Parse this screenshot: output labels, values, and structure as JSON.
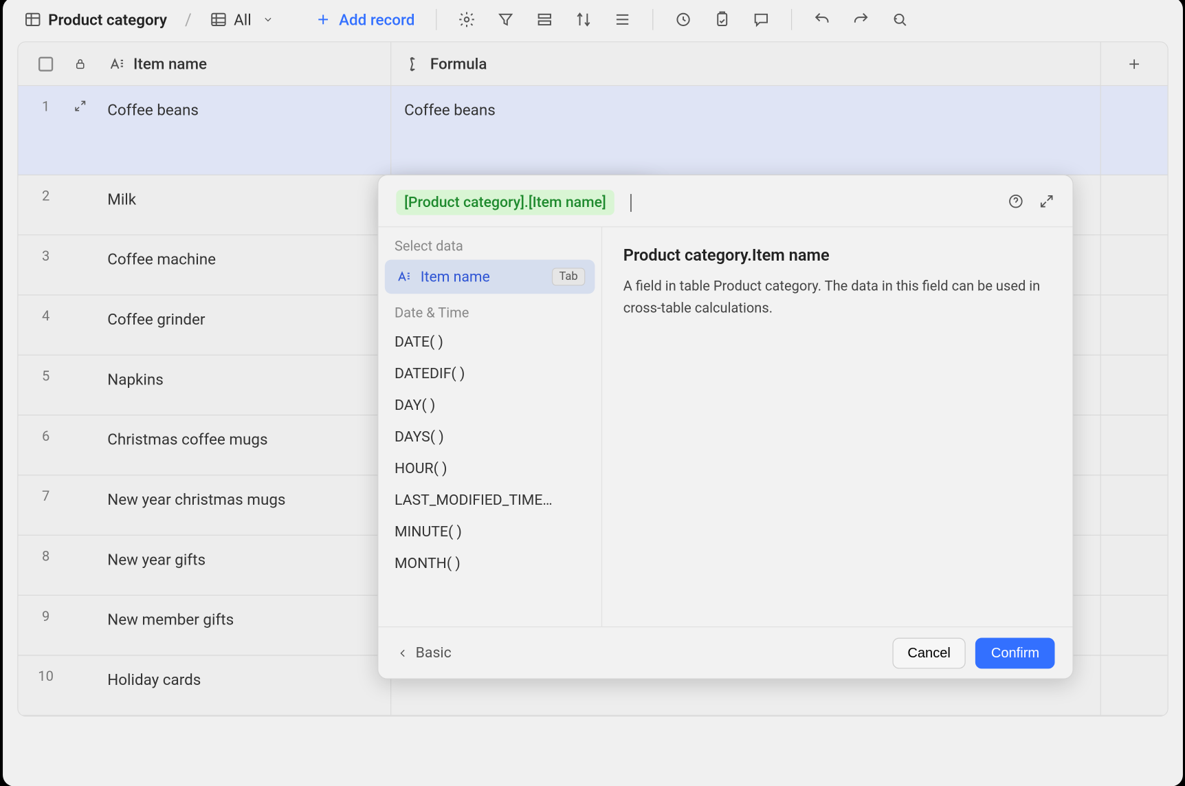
{
  "toolbar": {
    "title": "Product category",
    "view_label": "All",
    "add_record_label": "Add record"
  },
  "columns": {
    "item_name": "Item name",
    "formula": "Formula"
  },
  "rows": [
    {
      "num": "1",
      "item": "Coffee beans",
      "formula": "Coffee beans"
    },
    {
      "num": "2",
      "item": "Milk",
      "formula": ""
    },
    {
      "num": "3",
      "item": "Coffee machine",
      "formula": ""
    },
    {
      "num": "4",
      "item": "Coffee grinder",
      "formula": ""
    },
    {
      "num": "5",
      "item": "Napkins",
      "formula": ""
    },
    {
      "num": "6",
      "item": "Christmas coffee mugs",
      "formula": ""
    },
    {
      "num": "7",
      "item": "New year christmas mugs",
      "formula": ""
    },
    {
      "num": "8",
      "item": "New year gifts",
      "formula": ""
    },
    {
      "num": "9",
      "item": "New member gifts",
      "formula": ""
    },
    {
      "num": "10",
      "item": "Holiday cards",
      "formula": ""
    }
  ],
  "popover": {
    "chip_text": "[Product category].[Item name]",
    "groups": {
      "select_data": "Select data",
      "date_time": "Date & Time"
    },
    "selected_field": "Item name",
    "tab_hint": "Tab",
    "functions": [
      "DATE( )",
      "DATEDIF( )",
      "DAY( )",
      "DAYS( )",
      "HOUR( )",
      "LAST_MODIFIED_TIME…",
      "MINUTE( )",
      "MONTH( )"
    ],
    "detail_title": "Product category.Item name",
    "detail_desc": "A field in table Product category. The data in this field can be used in cross-table calculations.",
    "back_label": "Basic",
    "cancel_label": "Cancel",
    "confirm_label": "Confirm"
  }
}
